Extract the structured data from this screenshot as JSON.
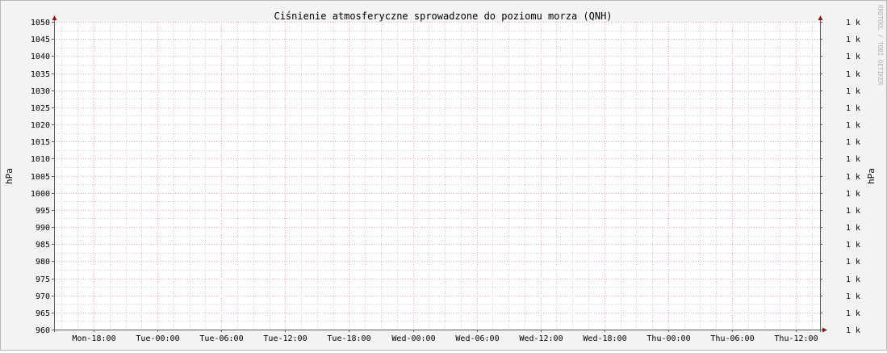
{
  "chart_data": {
    "type": "line",
    "title": "Ciśnienie atmosferyczne sprowadzone do poziomu morza (QNH)",
    "ylabel_left": "hPa",
    "ylabel_right": "hPa",
    "ylim": [
      960,
      1050
    ],
    "y_ticks": [
      960,
      965,
      970,
      975,
      980,
      985,
      990,
      995,
      1000,
      1005,
      1010,
      1015,
      1020,
      1025,
      1030,
      1035,
      1040,
      1045,
      1050
    ],
    "y_right_tick_label": "1 k",
    "x_ticks": [
      "Mon-18:00",
      "Tue-00:00",
      "Tue-06:00",
      "Tue-12:00",
      "Tue-18:00",
      "Wed-00:00",
      "Wed-06:00",
      "Wed-12:00",
      "Wed-18:00",
      "Thu-00:00",
      "Thu-06:00",
      "Thu-12:00"
    ],
    "grid": true,
    "series": [],
    "watermark": "RRDTOOL / TOBI OETIKER"
  },
  "colors": {
    "background": "#f3f3f3",
    "plot": "#ffffff",
    "major_grid": "#e8a3ad",
    "minor_grid": "#c9c9c9",
    "axis": "#5a5a5a",
    "arrow": "#8b1a1a",
    "text": "#000000",
    "watermark": "#b0b0b0"
  }
}
